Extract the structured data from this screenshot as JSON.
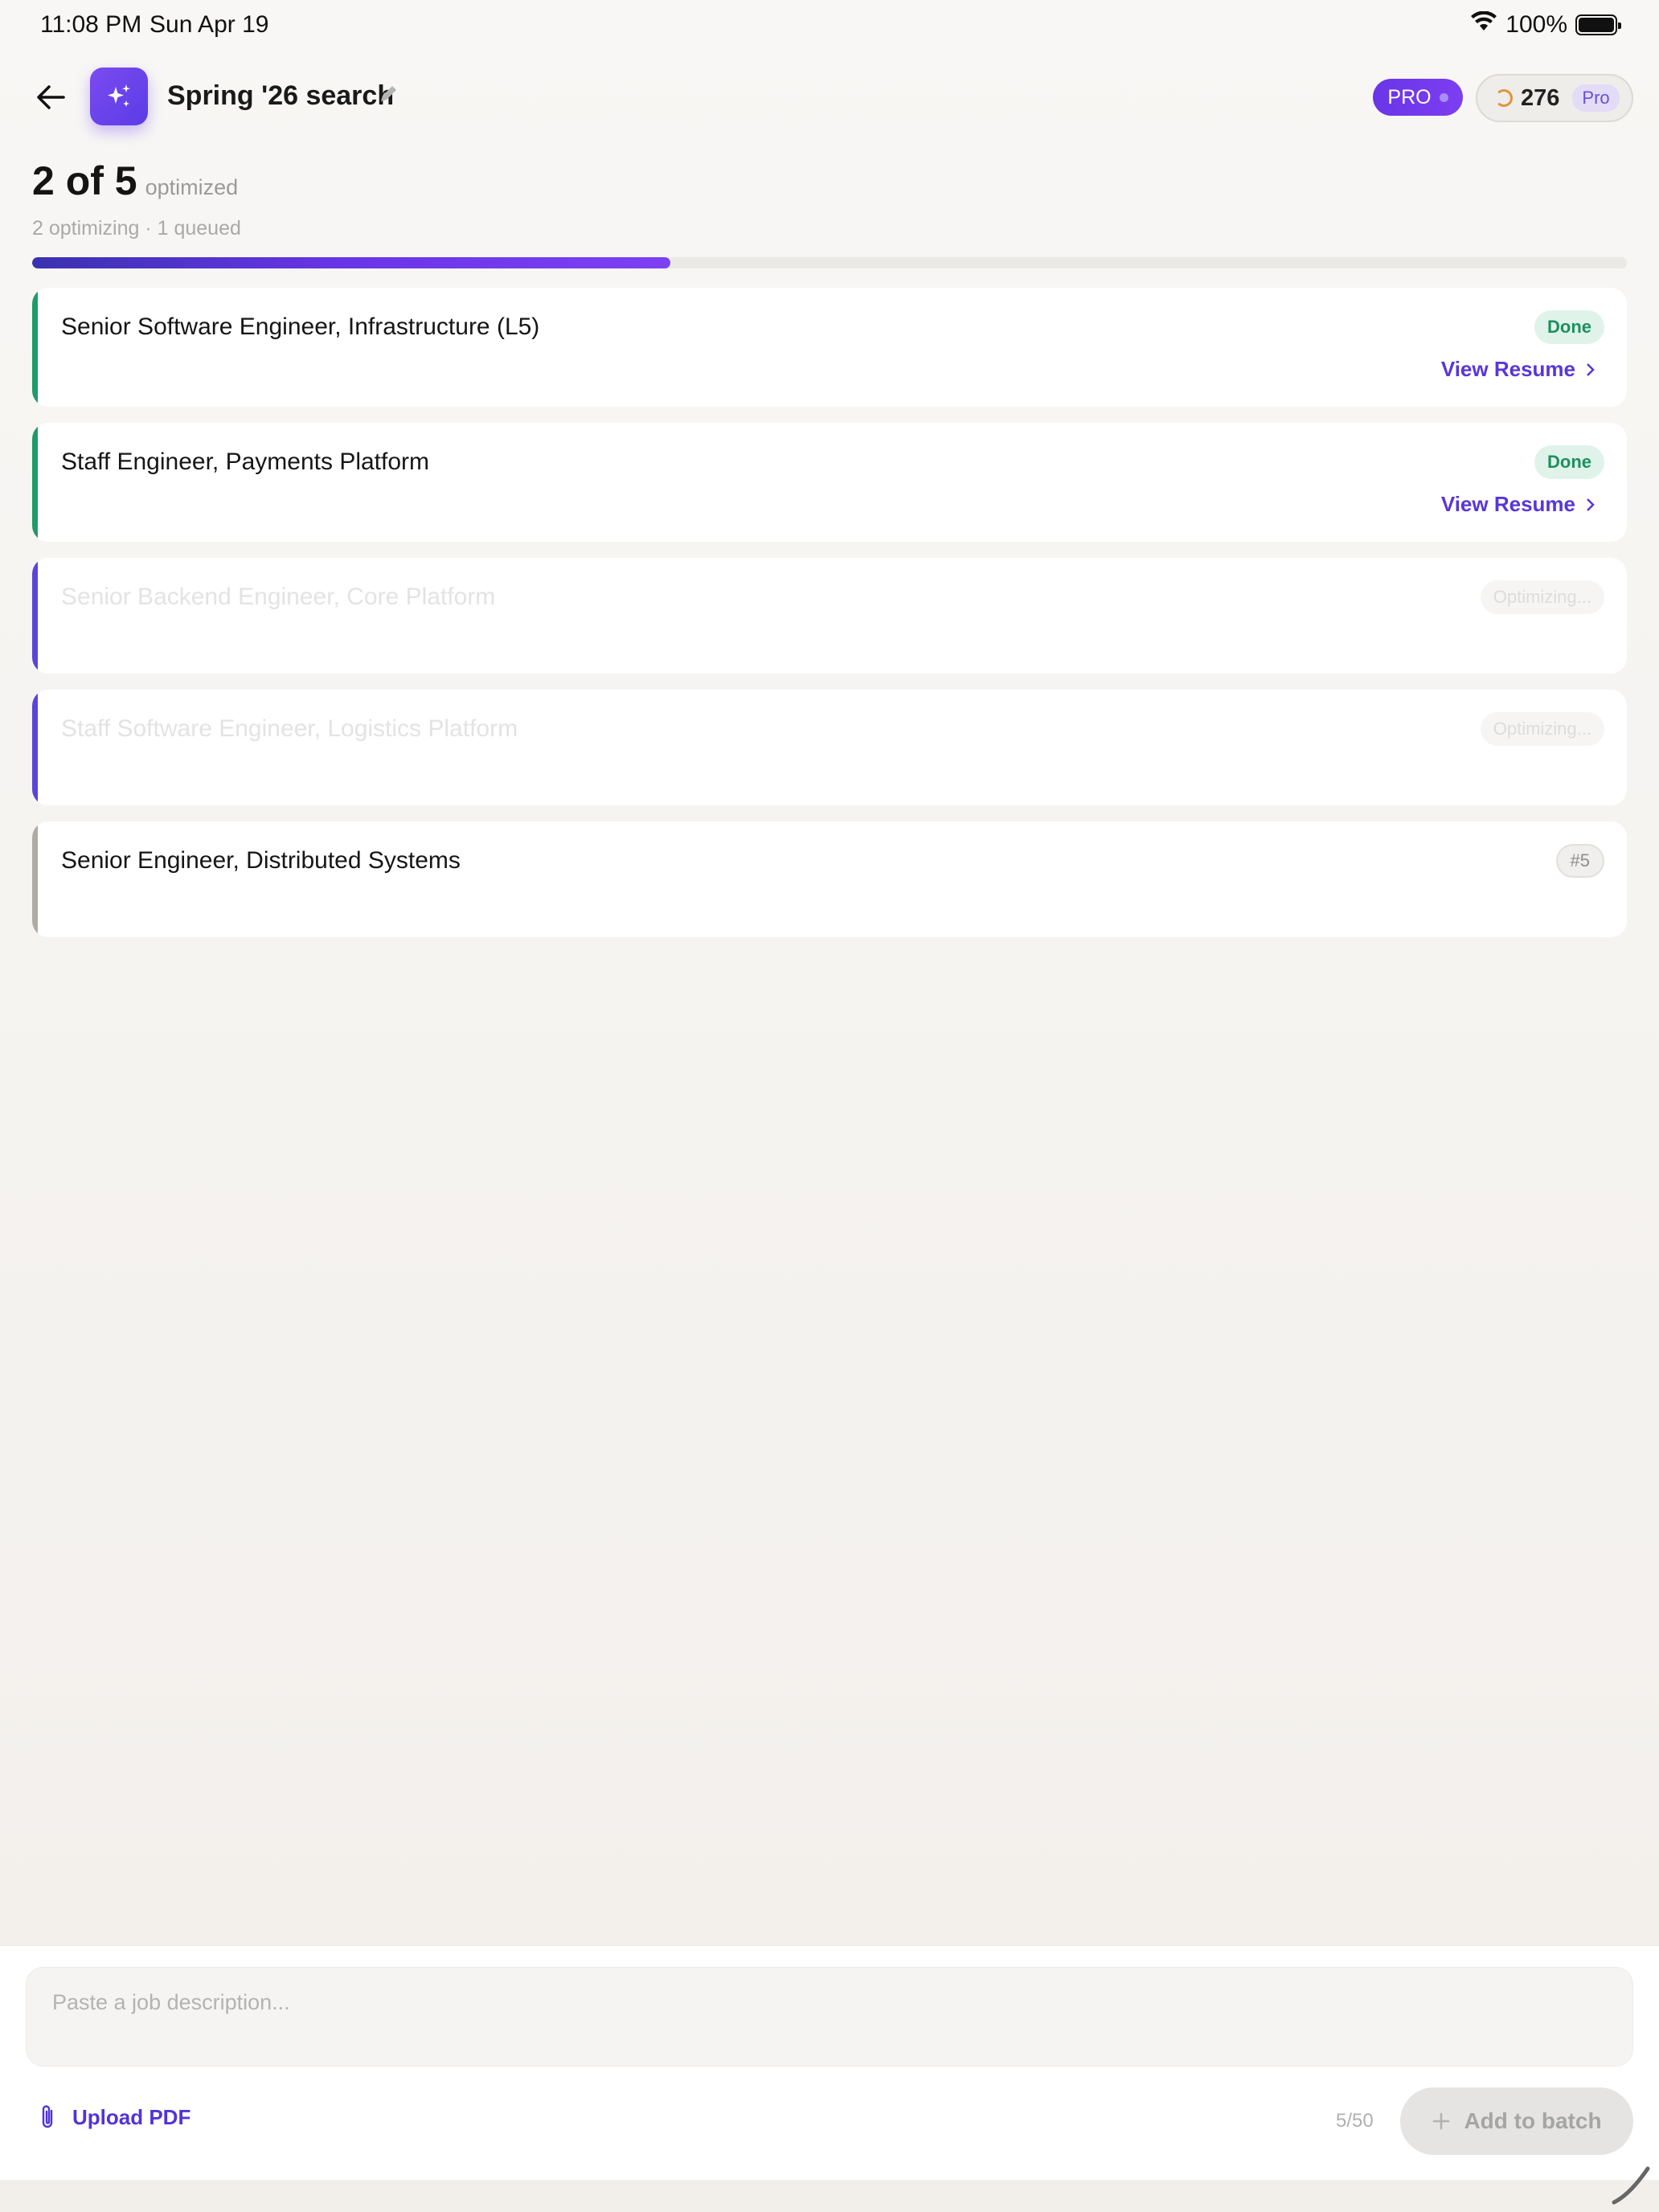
{
  "status_bar": {
    "time": "11:08 PM",
    "date": "Sun Apr 19",
    "battery": "100%"
  },
  "header": {
    "title": "Spring '26 search",
    "pro_label": "PRO",
    "credits": "276",
    "credits_tag": "Pro"
  },
  "summary": {
    "count": "2 of 5",
    "label": "optimized",
    "sub": "2 optimizing · 1 queued",
    "progress_fraction": 0.4
  },
  "jobs": [
    {
      "title": "Senior Software Engineer, Infrastructure (L5)",
      "status": "Done",
      "link": "View Resume"
    },
    {
      "title": "Staff Engineer, Payments Platform",
      "status": "Done",
      "link": "View Resume"
    },
    {
      "title": "Senior Backend Engineer, Core Platform",
      "status": "Optimizing..."
    },
    {
      "title": "Staff Software Engineer, Logistics Platform",
      "status": "Optimizing..."
    },
    {
      "title": "Senior Engineer, Distributed Systems",
      "status": "#5"
    }
  ],
  "composer": {
    "placeholder": "Paste a job description...",
    "upload_label": "Upload PDF",
    "counter": "5/50",
    "add_label": "Add to batch"
  },
  "colors": {
    "accent": "#6a35e8",
    "done": "#1f9a68",
    "optimizing": "#5a45d6",
    "queued": "#b0aaa4"
  }
}
